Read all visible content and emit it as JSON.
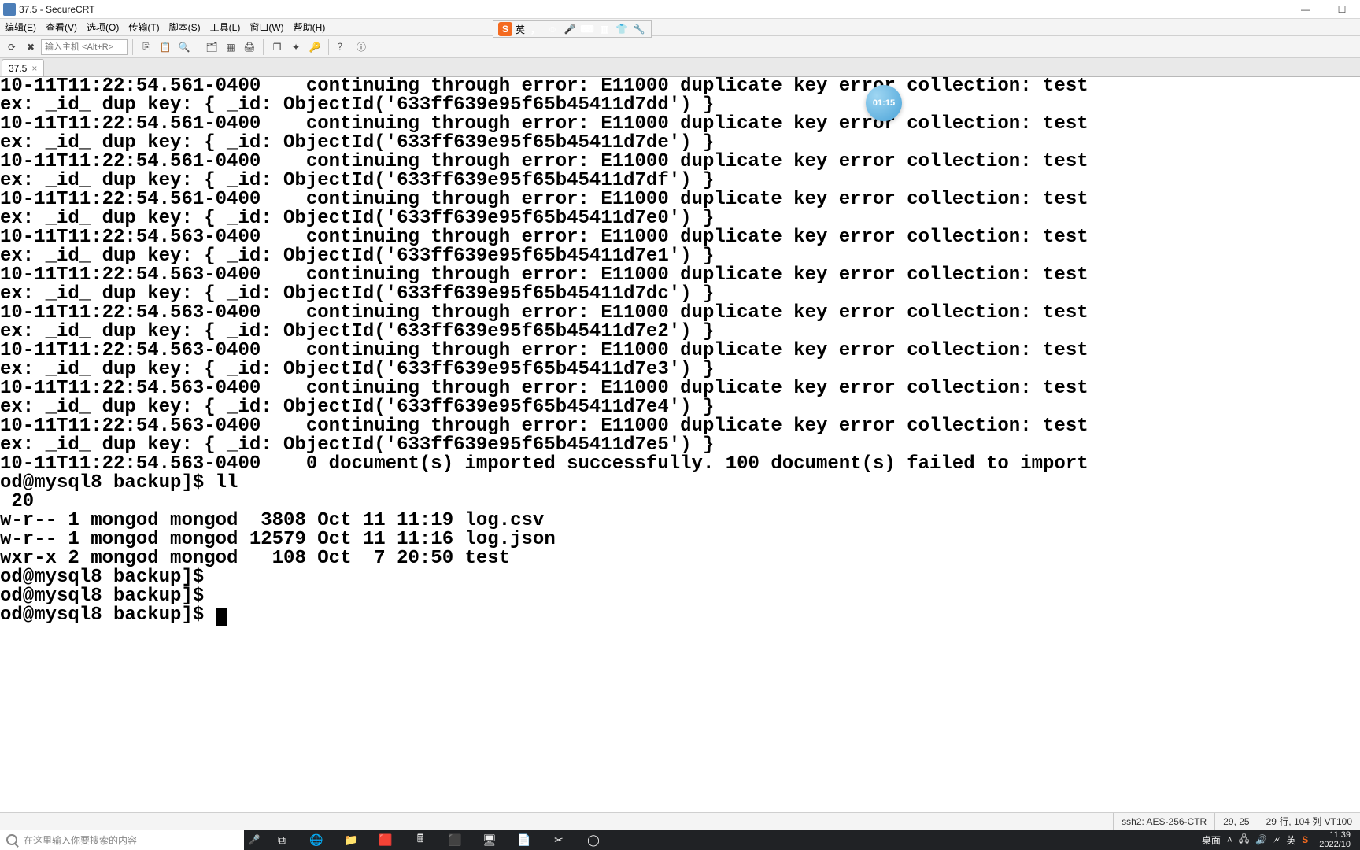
{
  "title": "37.5 - SecureCRT",
  "menu": [
    "编辑(E)",
    "查看(V)",
    "选项(O)",
    "传输(T)",
    "脚本(S)",
    "工具(L)",
    "窗口(W)",
    "帮助(H)"
  ],
  "ime": {
    "lang": "英"
  },
  "host_placeholder": "输入主机 <Alt+R>",
  "tab": {
    "label": "37.5"
  },
  "bubble_time": "01:15",
  "terminal_lines": [
    "10-11T11:22:54.561-0400    continuing through error: E11000 duplicate key error collection: test",
    "ex: _id_ dup key: { _id: ObjectId('633ff639e95f65b45411d7dd') }",
    "10-11T11:22:54.561-0400    continuing through error: E11000 duplicate key error collection: test",
    "ex: _id_ dup key: { _id: ObjectId('633ff639e95f65b45411d7de') }",
    "10-11T11:22:54.561-0400    continuing through error: E11000 duplicate key error collection: test",
    "ex: _id_ dup key: { _id: ObjectId('633ff639e95f65b45411d7df') }",
    "10-11T11:22:54.561-0400    continuing through error: E11000 duplicate key error collection: test",
    "ex: _id_ dup key: { _id: ObjectId('633ff639e95f65b45411d7e0') }",
    "10-11T11:22:54.563-0400    continuing through error: E11000 duplicate key error collection: test",
    "ex: _id_ dup key: { _id: ObjectId('633ff639e95f65b45411d7e1') }",
    "10-11T11:22:54.563-0400    continuing through error: E11000 duplicate key error collection: test",
    "ex: _id_ dup key: { _id: ObjectId('633ff639e95f65b45411d7dc') }",
    "10-11T11:22:54.563-0400    continuing through error: E11000 duplicate key error collection: test",
    "ex: _id_ dup key: { _id: ObjectId('633ff639e95f65b45411d7e2') }",
    "10-11T11:22:54.563-0400    continuing through error: E11000 duplicate key error collection: test",
    "ex: _id_ dup key: { _id: ObjectId('633ff639e95f65b45411d7e3') }",
    "10-11T11:22:54.563-0400    continuing through error: E11000 duplicate key error collection: test",
    "ex: _id_ dup key: { _id: ObjectId('633ff639e95f65b45411d7e4') }",
    "10-11T11:22:54.563-0400    continuing through error: E11000 duplicate key error collection: test",
    "ex: _id_ dup key: { _id: ObjectId('633ff639e95f65b45411d7e5') }",
    "10-11T11:22:54.563-0400    0 document(s) imported successfully. 100 document(s) failed to import",
    "od@mysql8 backup]$ ll",
    " 20",
    "w-r-- 1 mongod mongod  3808 Oct 11 11:19 log.csv",
    "w-r-- 1 mongod mongod 12579 Oct 11 11:16 log.json",
    "wxr-x 2 mongod mongod   108 Oct  7 20:50 test",
    "od@mysql8 backup]$ ",
    "od@mysql8 backup]$ ",
    "od@mysql8 backup]$ "
  ],
  "status": {
    "conn": "ssh2: AES-256-CTR",
    "pos": "29, 25",
    "size": "29 行, 104 列 VT100"
  },
  "taskbar": {
    "search_placeholder": "在这里输入你要搜索的内容",
    "sys_label_desktop": "桌面",
    "sys_label_lang": "英",
    "clock_time": "11:39",
    "clock_date": "2022/10"
  }
}
